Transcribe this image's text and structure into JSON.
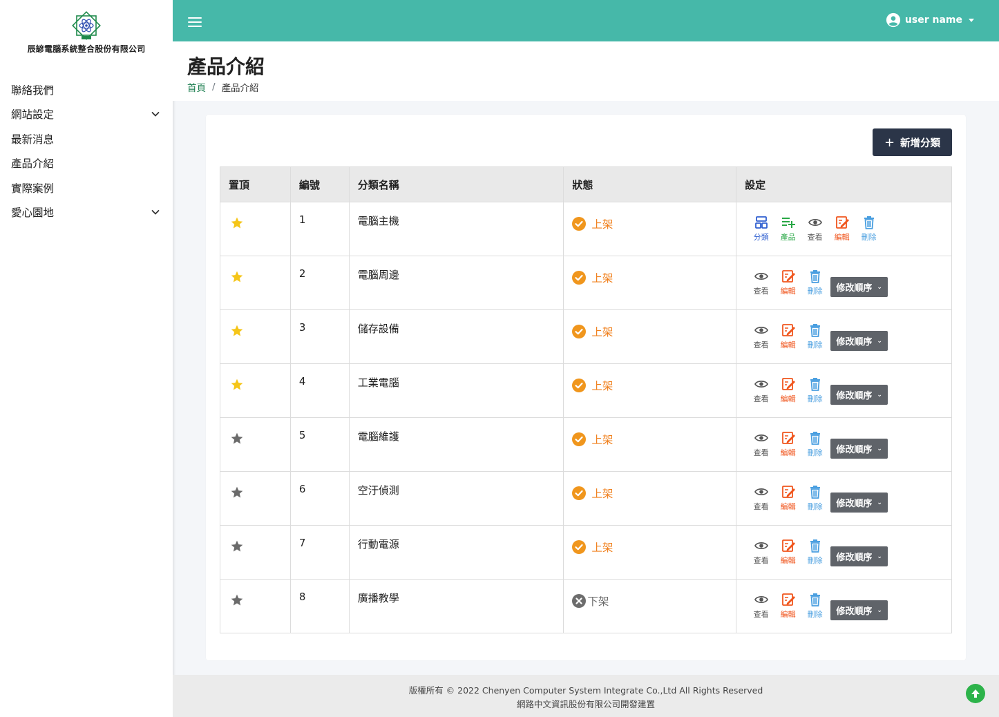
{
  "brand": {
    "name": "辰諺電腦系統整合股份有限公司",
    "logo_icon": "company-logo-icon"
  },
  "sidebar": {
    "items": [
      {
        "label": "聯絡我們",
        "expandable": false
      },
      {
        "label": "網站設定",
        "expandable": true
      },
      {
        "label": "最新消息",
        "expandable": false
      },
      {
        "label": "產品介紹",
        "expandable": false
      },
      {
        "label": "實際案例",
        "expandable": false
      },
      {
        "label": "愛心園地",
        "expandable": true
      }
    ]
  },
  "header": {
    "user_name": "user name",
    "accent_color": "#46b8a9"
  },
  "page": {
    "title": "產品介紹",
    "breadcrumb": {
      "home": "首頁",
      "separator": "/",
      "current": "產品介紹"
    }
  },
  "toolbar": {
    "add_label": "新增分類",
    "add_icon": "+"
  },
  "table": {
    "headers": [
      "置頂",
      "編號",
      "分類名稱",
      "狀態",
      "設定"
    ],
    "rows": [
      {
        "pinned": true,
        "id": "1",
        "name": "電腦主機",
        "status": "上架",
        "active": true
      },
      {
        "pinned": true,
        "id": "2",
        "name": "電腦周邊",
        "status": "上架",
        "active": true
      },
      {
        "pinned": true,
        "id": "3",
        "name": "儲存設備",
        "status": "上架",
        "active": true
      },
      {
        "pinned": true,
        "id": "4",
        "name": "工業電腦",
        "status": "上架",
        "active": true
      },
      {
        "pinned": false,
        "id": "5",
        "name": "電腦維護",
        "status": "上架",
        "active": true
      },
      {
        "pinned": false,
        "id": "6",
        "name": "空汙偵測",
        "status": "上架",
        "active": true
      },
      {
        "pinned": false,
        "id": "7",
        "name": "行動電源",
        "status": "上架",
        "active": true
      },
      {
        "pinned": false,
        "id": "8",
        "name": "廣播教學",
        "status": "下架",
        "active": false
      }
    ],
    "first_row_actions": [
      "分類",
      "產品",
      "查看",
      "編輯",
      "刪除"
    ],
    "row_actions": [
      "查看",
      "編輯",
      "刪除"
    ],
    "order_button": "修改順序",
    "order_chevron": "⌄"
  },
  "colors": {
    "star_on": "#f5c518",
    "star_off": "#6b6b6b",
    "status_on": "#f0801d",
    "status_off": "#6c6c6c"
  },
  "footer": {
    "line1": "版權所有 © 2022 Chenyen Computer System Integrate Co.,Ltd All Rights Reserved",
    "line2": "網路中文資訊股份有限公司開發建置"
  }
}
